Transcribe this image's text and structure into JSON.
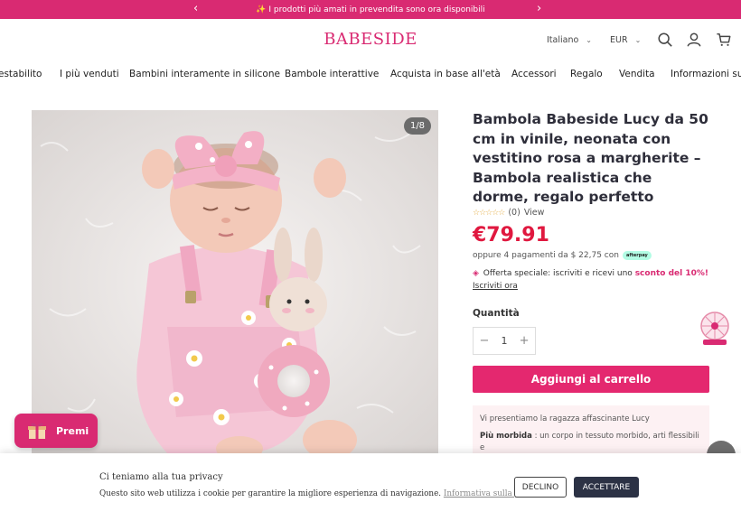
{
  "announcement": {
    "text": "✨ I prodotti più amati in prevendita sono ora disponibili",
    "prev": "‹",
    "next": "›"
  },
  "header": {
    "logo": "BABESIDE",
    "language": "Italiano",
    "currency": "EUR",
    "icons": [
      "search-icon",
      "account-icon",
      "cart-icon"
    ]
  },
  "nav": {
    "items": [
      "estabilito",
      "I più venduti",
      "Bambini interamente in silicone",
      "Bambole interattive",
      "Acquista in base all'età",
      "Accessori",
      "Regalo",
      "Vendita",
      "Informazioni su l"
    ]
  },
  "gallery": {
    "counter": "1/8"
  },
  "product": {
    "title": "Bambola Babeside Lucy da 50 cm in vinile, neonata con vestitino rosa a margherite – Bambola realistica che dorme, regalo perfetto",
    "stars": "☆☆☆☆☆",
    "review_count": "(0)",
    "view_link": "View",
    "price": "€79.91",
    "installments": "oppure 4 pagamenti da $ 22,75 con",
    "installments_provider": "afterpay",
    "offer_prefix": "Offerta speciale: iscriviti e ricevi uno",
    "offer_highlight": "sconto del 10%!",
    "offer_link": "Iscriviti ora",
    "quantity_label": "Quantità",
    "quantity_value": "1",
    "add_to_cart": "Aggiungi al carrello",
    "desc_intro": "Vi presentiamo la ragazza affascinante Lucy",
    "desc_label": "Più morbida",
    "desc_text": ": un corpo in tessuto morbido, arti flessibili e"
  },
  "widgets": {
    "premi": "Premi"
  },
  "cookie": {
    "title": "Ci teniamo alla tua privacy",
    "text": "Questo sito web utilizza i cookie per garantire la migliore esperienza di navigazione.",
    "policy_link": "Informativa sulla privacy",
    "decline": "DECLINO",
    "accept": "ACCETTARE"
  },
  "colors": {
    "brand": "#d92a72",
    "price": "#e0183f",
    "accept_button": "#2c3245"
  }
}
